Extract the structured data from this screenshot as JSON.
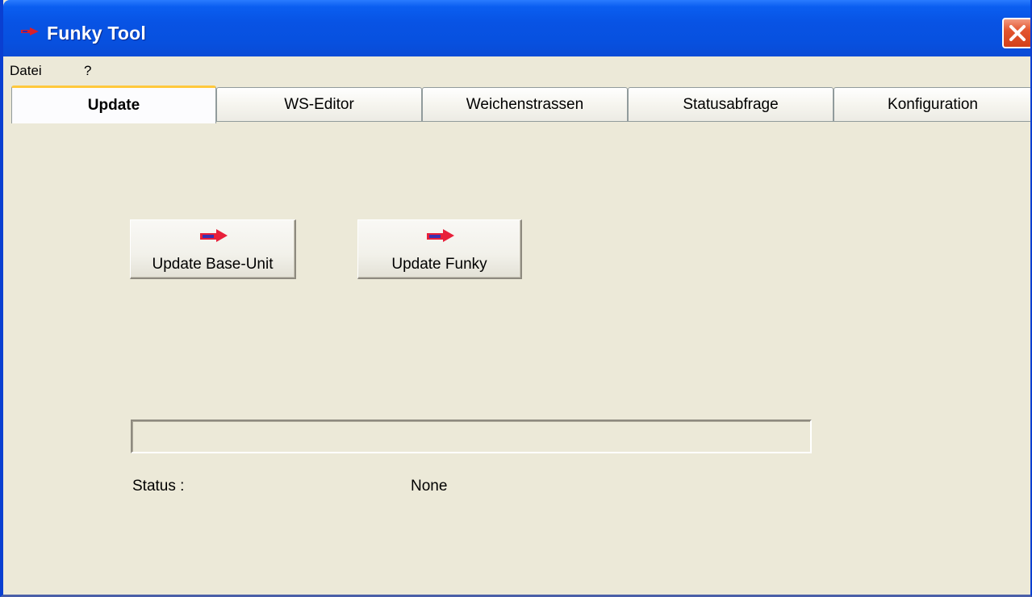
{
  "window": {
    "title": "Funky Tool",
    "title_icon": "funky-app-icon",
    "close_icon": "close-icon"
  },
  "menu": {
    "items": [
      "Datei",
      "?"
    ]
  },
  "tabs": [
    {
      "label": "Update",
      "active": true
    },
    {
      "label": "WS-Editor",
      "active": false
    },
    {
      "label": "Weichenstrassen",
      "active": false
    },
    {
      "label": "Statusabfrage",
      "active": false
    },
    {
      "label": "Konfiguration",
      "active": false
    }
  ],
  "update": {
    "buttons": [
      {
        "label": "Update Base-Unit",
        "icon": "arrow-right-icon"
      },
      {
        "label": "Update Funky",
        "icon": "arrow-right-icon"
      }
    ],
    "progress": 0,
    "status_label": "Status :",
    "status_value": "None"
  },
  "colors": {
    "titlebar": "#0853e4",
    "window_bg": "#ece9d8",
    "active_tab_highlight": "#ffc83c",
    "close_button": "#d2401a",
    "icon_arrow": "#e8203a",
    "icon_body": "#3a2fb0"
  }
}
